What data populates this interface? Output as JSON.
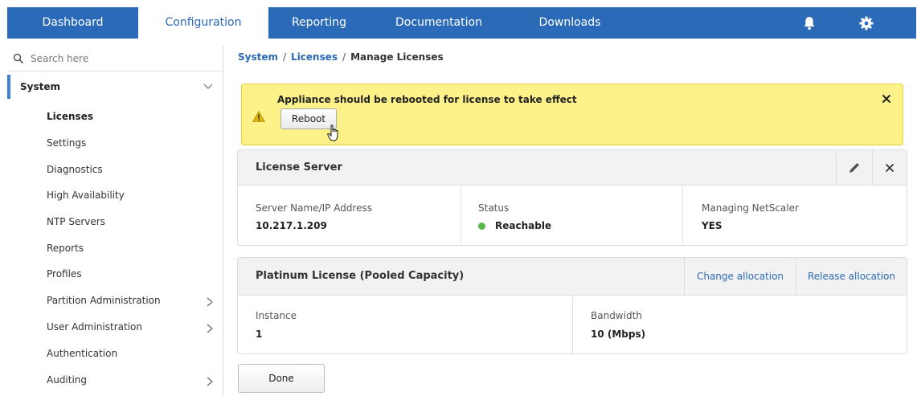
{
  "nav": {
    "items": [
      {
        "label": "Dashboard"
      },
      {
        "label": "Configuration"
      },
      {
        "label": "Reporting"
      },
      {
        "label": "Documentation"
      },
      {
        "label": "Downloads"
      }
    ],
    "active": "Configuration",
    "icons": [
      "bell-icon",
      "gear-icon"
    ]
  },
  "sidebar": {
    "search_placeholder": "Search here",
    "section": "System",
    "items": [
      {
        "label": "Licenses",
        "selected": true
      },
      {
        "label": "Settings"
      },
      {
        "label": "Diagnostics"
      },
      {
        "label": "High Availability"
      },
      {
        "label": "NTP Servers"
      },
      {
        "label": "Reports"
      },
      {
        "label": "Profiles"
      },
      {
        "label": "Partition Administration",
        "has_children": true
      },
      {
        "label": "User Administration",
        "has_children": true
      },
      {
        "label": "Authentication"
      },
      {
        "label": "Auditing",
        "has_children": true
      }
    ]
  },
  "breadcrumb": {
    "items": [
      "System",
      "Licenses",
      "Manage Licenses"
    ],
    "separator": "/"
  },
  "alert": {
    "message": "Appliance should be rebooted for license to take effect",
    "button": "Reboot"
  },
  "license_server": {
    "title": "License Server",
    "fields": [
      {
        "label": "Server Name/IP Address",
        "value": "10.217.1.209"
      },
      {
        "label": "Status",
        "value": "Reachable"
      },
      {
        "label": "Managing NetScaler",
        "value": "YES"
      }
    ]
  },
  "platinum": {
    "title": "Platinum License (Pooled Capacity)",
    "actions": [
      "Change allocation",
      "Release allocation"
    ],
    "fields": [
      {
        "label": "Instance",
        "value": "1"
      },
      {
        "label": "Bandwidth",
        "value": "10 (Mbps)"
      }
    ]
  },
  "done_label": "Done",
  "colors": {
    "nav_bg": "#2a6ab7",
    "alert_bg": "#fdf28a",
    "status_ok": "#58b947",
    "link": "#2a6ab7"
  }
}
